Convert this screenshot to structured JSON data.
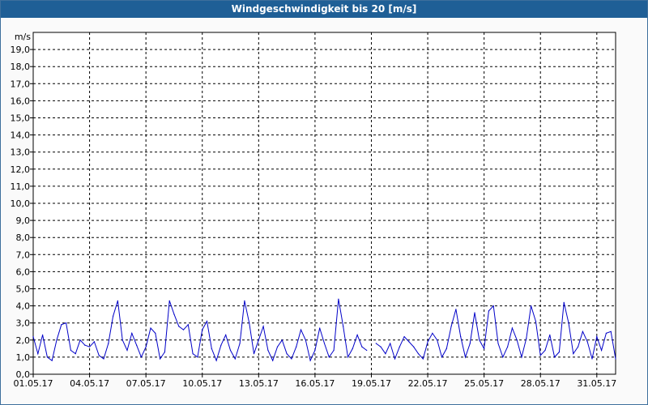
{
  "window": {
    "title": "Windgeschwindigkeit bis 20 [m/s]"
  },
  "chart_data": {
    "type": "line",
    "title": "Windgeschwindigkeit bis 20 [m/s]",
    "ylabel": "m/s",
    "xlabel": "",
    "ylim": [
      0,
      20
    ],
    "xlim": [
      "01.05.17",
      "01.06.17"
    ],
    "grid": true,
    "line_color": "#0000c8",
    "x_tick_labels": [
      "01.05.17",
      "04.05.17",
      "07.05.17",
      "10.05.17",
      "13.05.17",
      "16.05.17",
      "19.05.17",
      "22.05.17",
      "25.05.17",
      "28.05.17",
      "31.05.17"
    ],
    "y_tick_labels": [
      "0,0",
      "1,0",
      "2,0",
      "3,0",
      "4,0",
      "5,0",
      "6,0",
      "7,0",
      "8,0",
      "9,0",
      "10,0",
      "11,0",
      "12,0",
      "13,0",
      "14,0",
      "15,0",
      "16,0",
      "17,0",
      "18,0",
      "19,0"
    ],
    "series": [
      {
        "segments": [
          {
            "x": [
              "01.05.17",
              "01.05.17 06h",
              "01.05.17 12h",
              "01.05.17 18h",
              "02.05.17",
              "02.05.17 06h",
              "02.05.17 12h",
              "02.05.17 18h",
              "03.05.17",
              "03.05.17 06h",
              "03.05.17 12h",
              "03.05.17 18h",
              "04.05.17",
              "04.05.17 06h",
              "04.05.17 12h",
              "04.05.17 18h",
              "05.05.17",
              "05.05.17 06h",
              "05.05.17 12h",
              "05.05.17 18h",
              "06.05.17",
              "06.05.17 06h",
              "06.05.17 12h",
              "06.05.17 18h",
              "07.05.17",
              "07.05.17 06h",
              "07.05.17 12h",
              "07.05.17 18h",
              "08.05.17",
              "08.05.17 06h",
              "08.05.17 12h",
              "08.05.17 18h",
              "09.05.17",
              "09.05.17 06h",
              "09.05.17 12h",
              "09.05.17 18h",
              "10.05.17",
              "10.05.17 06h",
              "10.05.17 12h",
              "10.05.17 18h",
              "11.05.17",
              "11.05.17 06h",
              "11.05.17 12h",
              "11.05.17 18h",
              "12.05.17",
              "12.05.17 06h",
              "12.05.17 12h",
              "12.05.17 18h",
              "13.05.17",
              "13.05.17 06h",
              "13.05.17 12h",
              "13.05.17 18h",
              "14.05.17",
              "14.05.17 06h",
              "14.05.17 12h",
              "14.05.17 18h",
              "15.05.17",
              "15.05.17 06h",
              "15.05.17 12h",
              "15.05.17 18h",
              "16.05.17",
              "16.05.17 06h",
              "16.05.17 12h",
              "16.05.17 18h",
              "17.05.17",
              "17.05.17 06h",
              "17.05.17 12h",
              "17.05.17 18h",
              "18.05.17",
              "18.05.17 06h",
              "18.05.17 12h",
              "18.05.17 18h"
            ],
            "y": [
              2.2,
              1.2,
              2.3,
              1.0,
              0.8,
              2.0,
              2.9,
              3.0,
              1.4,
              1.2,
              2.0,
              1.7,
              1.6,
              1.9,
              1.1,
              0.9,
              1.8,
              3.4,
              4.3,
              2.0,
              1.4,
              2.4,
              1.7,
              1.0,
              1.6,
              2.7,
              2.4,
              0.9,
              1.3,
              4.3,
              3.5,
              2.8,
              2.6,
              2.9,
              1.2,
              1.0,
              2.6,
              3.1,
              1.5,
              0.8,
              1.7,
              2.3,
              1.4,
              0.9,
              1.8,
              4.3,
              3.0,
              1.2,
              2.0,
              2.8,
              1.4,
              0.8,
              1.6,
              2.0,
              1.2,
              0.9,
              1.6,
              2.6,
              2.0,
              0.8,
              1.4,
              2.7,
              1.8,
              1.0,
              1.4,
              4.4,
              2.8,
              1.0,
              1.5,
              2.3,
              1.6,
              1.4
            ]
          },
          {
            "x": [
              "19.05.17 06h",
              "19.05.17 12h",
              "19.05.17 18h",
              "20.05.17",
              "20.05.17 06h",
              "20.05.17 12h",
              "20.05.17 18h",
              "21.05.17",
              "21.05.17 06h",
              "21.05.17 12h",
              "21.05.17 18h",
              "22.05.17",
              "22.05.17 06h",
              "22.05.17 12h",
              "22.05.17 18h",
              "23.05.17",
              "23.05.17 06h",
              "23.05.17 12h",
              "23.05.17 18h",
              "24.05.17",
              "24.05.17 06h",
              "24.05.17 12h",
              "24.05.17 18h",
              "25.05.17",
              "25.05.17 06h",
              "25.05.17 12h",
              "25.05.17 18h",
              "26.05.17",
              "26.05.17 06h",
              "26.05.17 12h",
              "26.05.17 18h",
              "27.05.17",
              "27.05.17 06h",
              "27.05.17 12h",
              "27.05.17 18h",
              "28.05.17",
              "28.05.17 06h",
              "28.05.17 12h",
              "28.05.17 18h",
              "29.05.17",
              "29.05.17 06h",
              "29.05.17 12h",
              "29.05.17 18h",
              "30.05.17",
              "30.05.17 06h",
              "30.05.17 12h",
              "30.05.17 18h",
              "31.05.17",
              "31.05.17 06h",
              "31.05.17 12h",
              "31.05.17 18h",
              "01.06.17"
            ],
            "y": [
              1.8,
              1.6,
              1.2,
              1.8,
              0.9,
              1.6,
              2.2,
              1.9,
              1.6,
              1.2,
              0.9,
              1.9,
              2.4,
              2.0,
              1.0,
              1.5,
              2.8,
              3.8,
              2.2,
              1.0,
              1.8,
              3.6,
              2.0,
              1.5,
              3.7,
              4.0,
              1.8,
              1.0,
              1.6,
              2.7,
              2.0,
              1.0,
              2.1,
              4.0,
              3.1,
              1.1,
              1.4,
              2.3,
              1.0,
              1.3,
              4.2,
              3.0,
              1.2,
              1.6,
              2.5,
              1.9,
              0.9,
              2.2,
              1.4,
              2.4,
              2.5,
              0.9
            ]
          }
        ]
      }
    ]
  }
}
